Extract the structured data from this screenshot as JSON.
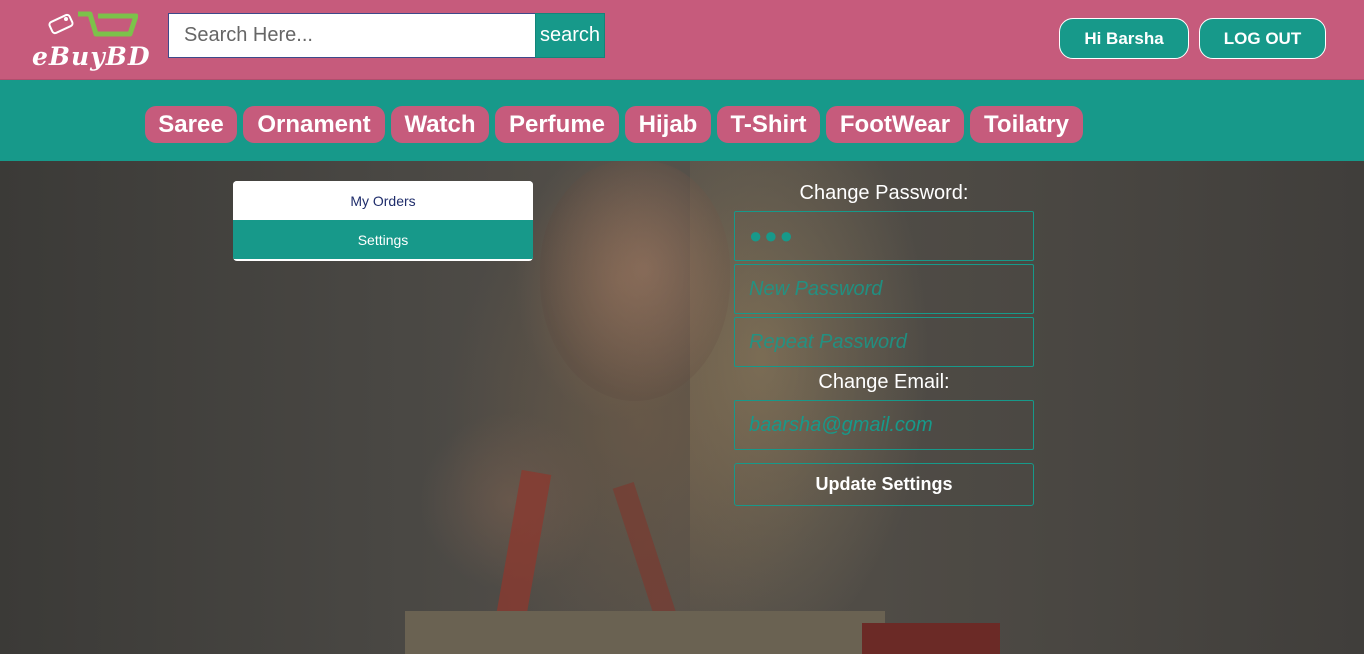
{
  "header": {
    "logo_text": "eBuyBD",
    "search": {
      "placeholder": "Search Here...",
      "value": "",
      "button_label": "search"
    },
    "greeting_button": "Hi Barsha",
    "logout_button": "LOG OUT"
  },
  "nav": {
    "items": [
      {
        "label": "Saree"
      },
      {
        "label": "Ornament"
      },
      {
        "label": "Watch"
      },
      {
        "label": "Perfume"
      },
      {
        "label": "Hijab"
      },
      {
        "label": "T-Shirt"
      },
      {
        "label": "FootWear"
      },
      {
        "label": "Toilatry"
      }
    ]
  },
  "account_tabs": {
    "orders_label": "My Orders",
    "settings_label": "Settings",
    "active": "Settings"
  },
  "settings_form": {
    "change_password_label": "Change Password:",
    "current_password_value": "●●●",
    "new_password_placeholder": "New Password",
    "repeat_password_placeholder": "Repeat Password",
    "change_email_label": "Change Email:",
    "email_value": "baarsha@gmail.com",
    "update_button": "Update Settings"
  },
  "colors": {
    "brand_pink": "#c65b7c",
    "brand_teal": "#17998a"
  }
}
